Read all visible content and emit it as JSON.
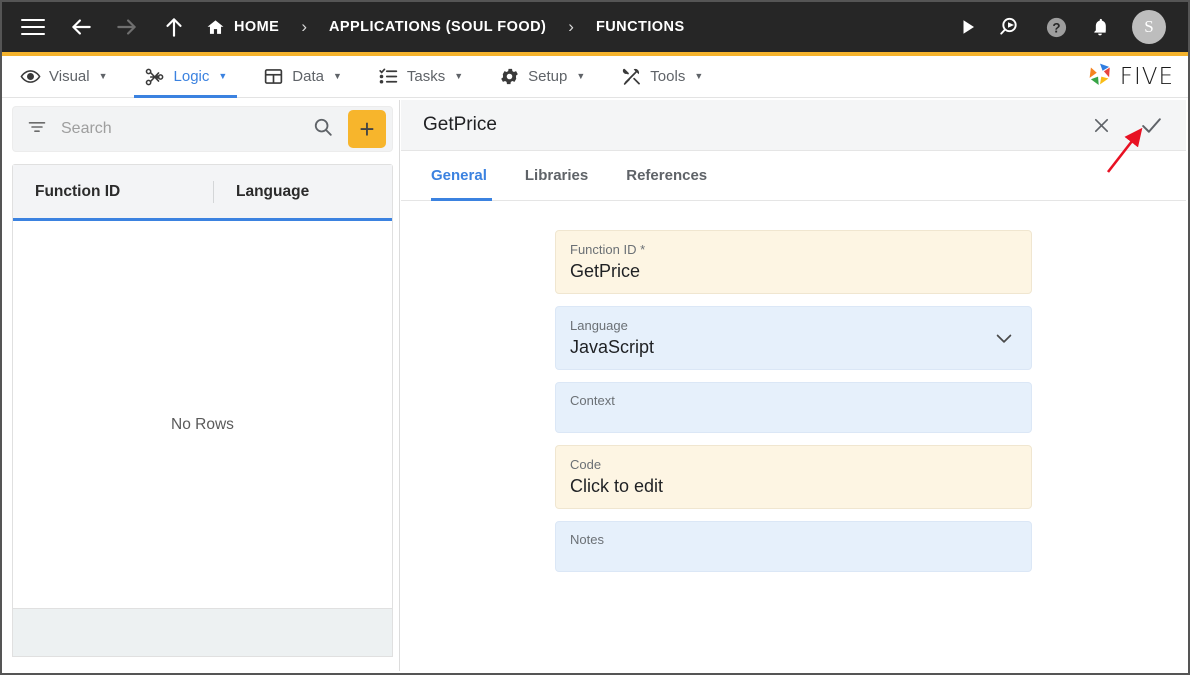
{
  "topbar": {
    "menu_icon": "hamburger-icon",
    "back_icon": "arrow-left-icon",
    "forward_icon": "arrow-right-icon",
    "up_icon": "arrow-up-icon",
    "breadcrumbs": [
      {
        "label": "HOME",
        "icon": "home-icon"
      },
      {
        "label": "APPLICATIONS (SOUL FOOD)",
        "icon": ""
      },
      {
        "label": "FUNCTIONS",
        "icon": ""
      }
    ],
    "separator": "›",
    "actions": [
      {
        "name": "run-icon",
        "label": "Run"
      },
      {
        "name": "search-query-icon",
        "label": "Search"
      },
      {
        "name": "help-icon",
        "label": "Help"
      },
      {
        "name": "notifications-icon",
        "label": "Notifications"
      }
    ],
    "avatar_initial": "S",
    "accent_color": "#F5B32C",
    "background_color": "#262626"
  },
  "nav": {
    "items": [
      {
        "label": "Visual",
        "icon": "eye-icon",
        "caret": "▼",
        "active": false
      },
      {
        "label": "Logic",
        "icon": "logic-nodes-icon",
        "caret": "▼",
        "active": true
      },
      {
        "label": "Data",
        "icon": "table-grid-icon",
        "caret": "▼",
        "active": false
      },
      {
        "label": "Tasks",
        "icon": "checklist-icon",
        "caret": "▼",
        "active": false
      },
      {
        "label": "Setup",
        "icon": "gear-icon",
        "caret": "▼",
        "active": false
      },
      {
        "label": "Tools",
        "icon": "tools-icon",
        "caret": "▼",
        "active": false
      }
    ],
    "active_color": "#3b82e0",
    "brand": {
      "text": "FIVE",
      "logo": "five-pinwheel-logo"
    }
  },
  "left_panel": {
    "search": {
      "placeholder": "Search",
      "value": "",
      "filter_icon": "filter-icon",
      "search_icon": "search-icon"
    },
    "add_button": {
      "label": "+",
      "name": "add-record-button",
      "color": "#F7B52C"
    },
    "grid": {
      "columns": [
        "Function ID",
        "Language"
      ],
      "rows": [],
      "empty_message": "No Rows",
      "header_underline_color": "#3b82e0"
    }
  },
  "right_panel": {
    "title": "GetPrice",
    "actions": [
      {
        "name": "close-button",
        "glyph": "✕"
      },
      {
        "name": "save-check-button",
        "glyph": "✓"
      }
    ],
    "tabs": [
      {
        "label": "General",
        "active": true
      },
      {
        "label": "Libraries",
        "active": false
      },
      {
        "label": "References",
        "active": false
      }
    ],
    "fields": [
      {
        "name": "function-id-field",
        "label": "Function ID *",
        "value": "GetPrice",
        "style": "cream",
        "control": "text"
      },
      {
        "name": "language-field",
        "label": "Language",
        "value": "JavaScript",
        "style": "blue",
        "control": "select"
      },
      {
        "name": "context-field",
        "label": "Context",
        "value": "",
        "style": "blue",
        "control": "text"
      },
      {
        "name": "code-field",
        "label": "Code",
        "value": "Click to edit",
        "style": "cream",
        "control": "text"
      },
      {
        "name": "notes-field",
        "label": "Notes",
        "value": "",
        "style": "blue",
        "control": "text"
      }
    ]
  },
  "annotation": {
    "type": "arrow",
    "color": "#e81123",
    "points_to": "save-check-button"
  }
}
